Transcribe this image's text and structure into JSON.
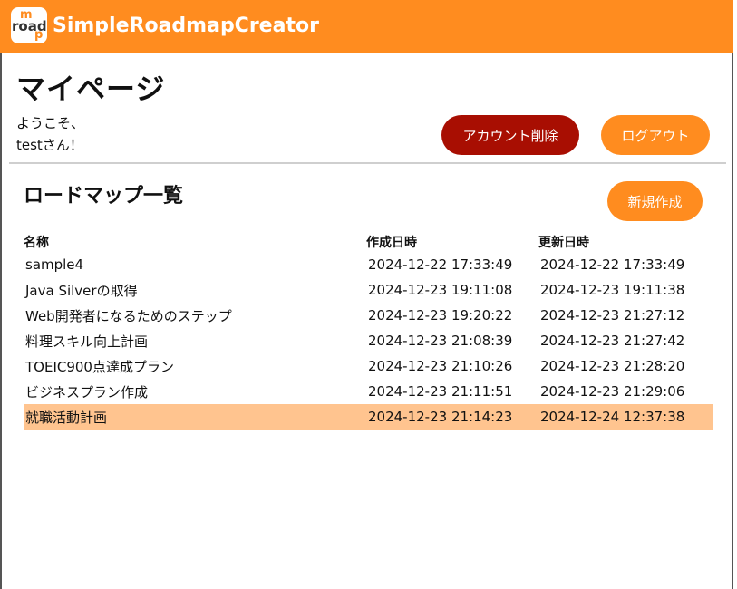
{
  "header": {
    "logo_text_top": "m",
    "logo_text_mid": "road",
    "logo_text_bottom": "p",
    "title": "SimpleRoadmapCreator",
    "color": "#ff8c1f"
  },
  "page": {
    "title": "マイページ",
    "welcome_line1": "ようこそ、",
    "welcome_line2": "testさん！"
  },
  "actions": {
    "delete_account": "アカウント削除",
    "delete_color": "#a80e02",
    "logout": "ログアウト",
    "logout_color": "#ff8c1f"
  },
  "roadmaps": {
    "section_title": "ロードマップ一覧",
    "new_button": "新規作成",
    "columns": {
      "name": "名称",
      "created": "作成日時",
      "updated": "更新日時"
    },
    "rows": [
      {
        "name": "sample4",
        "created": "2024-12-22 17:33:49",
        "updated": "2024-12-22 17:33:49"
      },
      {
        "name": "Java Silverの取得",
        "created": "2024-12-23 19:11:08",
        "updated": "2024-12-23 19:11:38"
      },
      {
        "name": "Web開発者になるためのステップ",
        "created": "2024-12-23 19:20:22",
        "updated": "2024-12-23 21:27:12"
      },
      {
        "name": "料理スキル向上計画",
        "created": "2024-12-23 21:08:39",
        "updated": "2024-12-23 21:27:42"
      },
      {
        "name": "TOEIC900点達成プラン",
        "created": "2024-12-23 21:10:26",
        "updated": "2024-12-23 21:28:20"
      },
      {
        "name": "ビジネスプラン作成",
        "created": "2024-12-23 21:11:51",
        "updated": "2024-12-23 21:29:06"
      },
      {
        "name": "就職活動計画",
        "created": "2024-12-23 21:14:23",
        "updated": "2024-12-24 12:37:38"
      }
    ],
    "selected_row_color": "#ffc48f"
  }
}
